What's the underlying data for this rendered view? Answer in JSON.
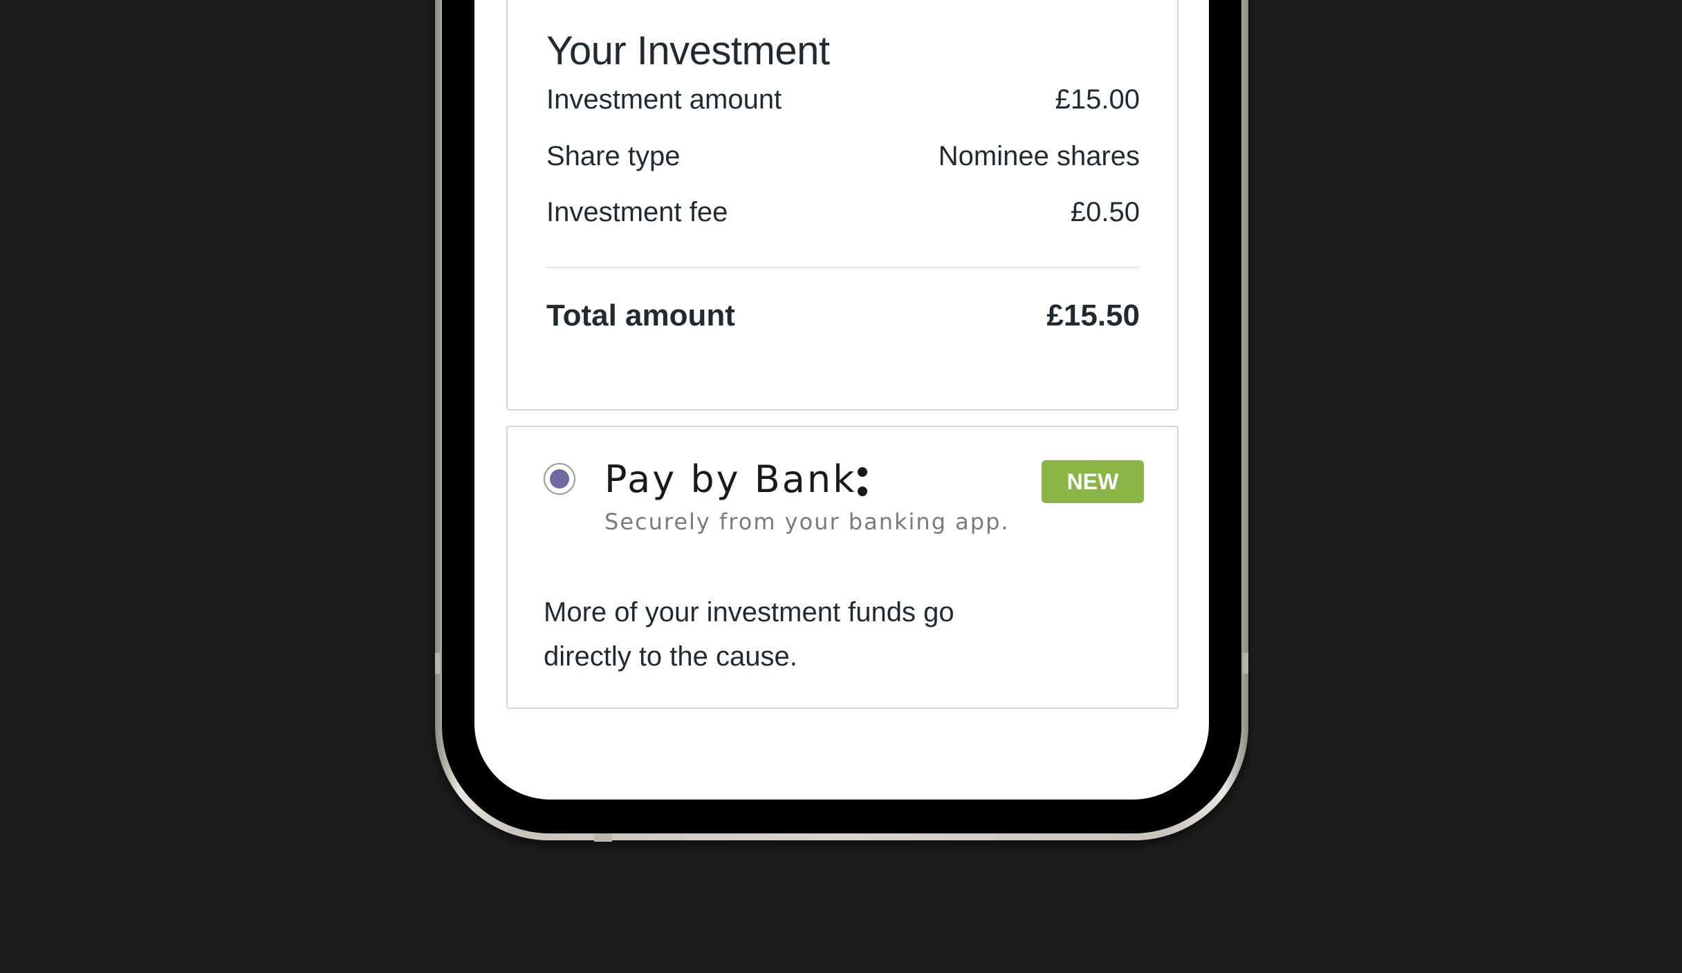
{
  "investment": {
    "title": "Your Investment",
    "rows": [
      {
        "label": "Investment amount",
        "value": "£15.00"
      },
      {
        "label": "Share type",
        "value": "Nominee shares"
      },
      {
        "label": "Investment fee",
        "value": "£0.50"
      }
    ],
    "total": {
      "label": "Total amount",
      "value": "£15.50"
    }
  },
  "payment": {
    "selected": true,
    "title": "Pay by Bank",
    "subtitle": "Securely from your banking app.",
    "badge": "NEW",
    "description": "More of your investment funds go directly to the cause."
  },
  "colors": {
    "radio_selected": "#6d6ba1",
    "badge_bg": "#8bb546",
    "text": "#1f2b30",
    "background": "#1c1c1c"
  }
}
